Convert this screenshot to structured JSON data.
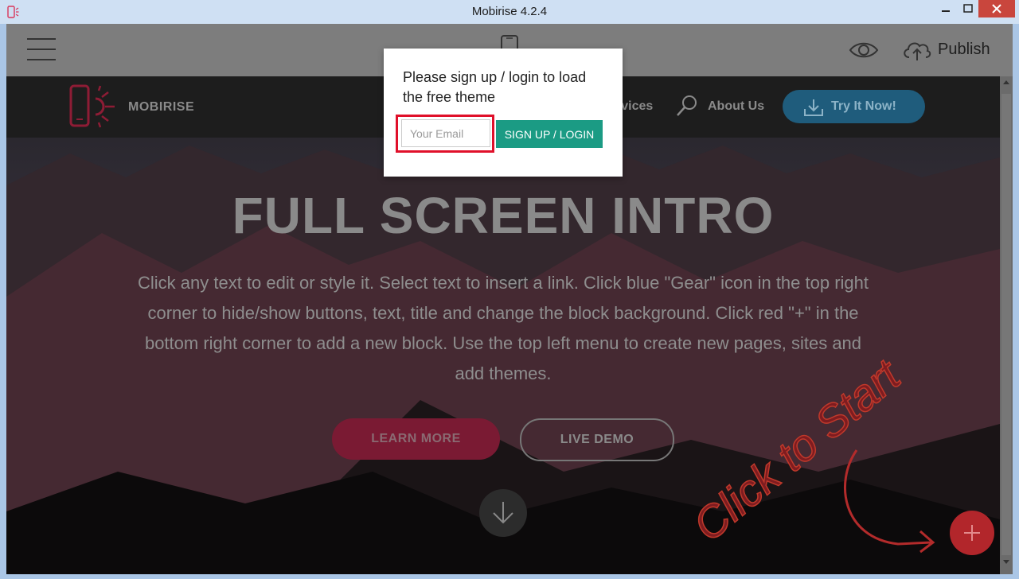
{
  "window": {
    "title": "Mobirise 4.2.4",
    "close_color": "#c9463d"
  },
  "toolbar": {
    "menu_icon": "hamburger-icon",
    "device_icon": "mobile-phone-icon",
    "preview_icon": "eye-icon",
    "publish_icon": "cloud-upload-icon",
    "publish_label": "Publish"
  },
  "site_nav": {
    "brand": "MOBIRISE",
    "items": [
      "rvices",
      "About Us"
    ],
    "cta_label": "Try It Now!",
    "cta_color": "#1f5c7c"
  },
  "hero": {
    "title": "FULL SCREEN INTRO",
    "text": "Click any text to edit or style it. Select text to insert a link. Click blue \"Gear\" icon in the top right corner to hide/show buttons, text, title and change the block background. Click red \"+\" in the bottom right corner to add a new block. Use the top left menu to create new pages, sites and add themes.",
    "primary_button": "LEARN MORE",
    "secondary_button": "LIVE DEMO",
    "primary_color": "#c42045"
  },
  "hint": {
    "label": "Click to Start"
  },
  "modal": {
    "message": "Please sign up / login to load the free theme",
    "email_placeholder": "Your Email",
    "email_value": "",
    "button_label": "SIGN UP / LOGIN",
    "button_color": "#1b9b84",
    "highlight_color": "#e0102a"
  },
  "add_block_color": "#b2262b"
}
